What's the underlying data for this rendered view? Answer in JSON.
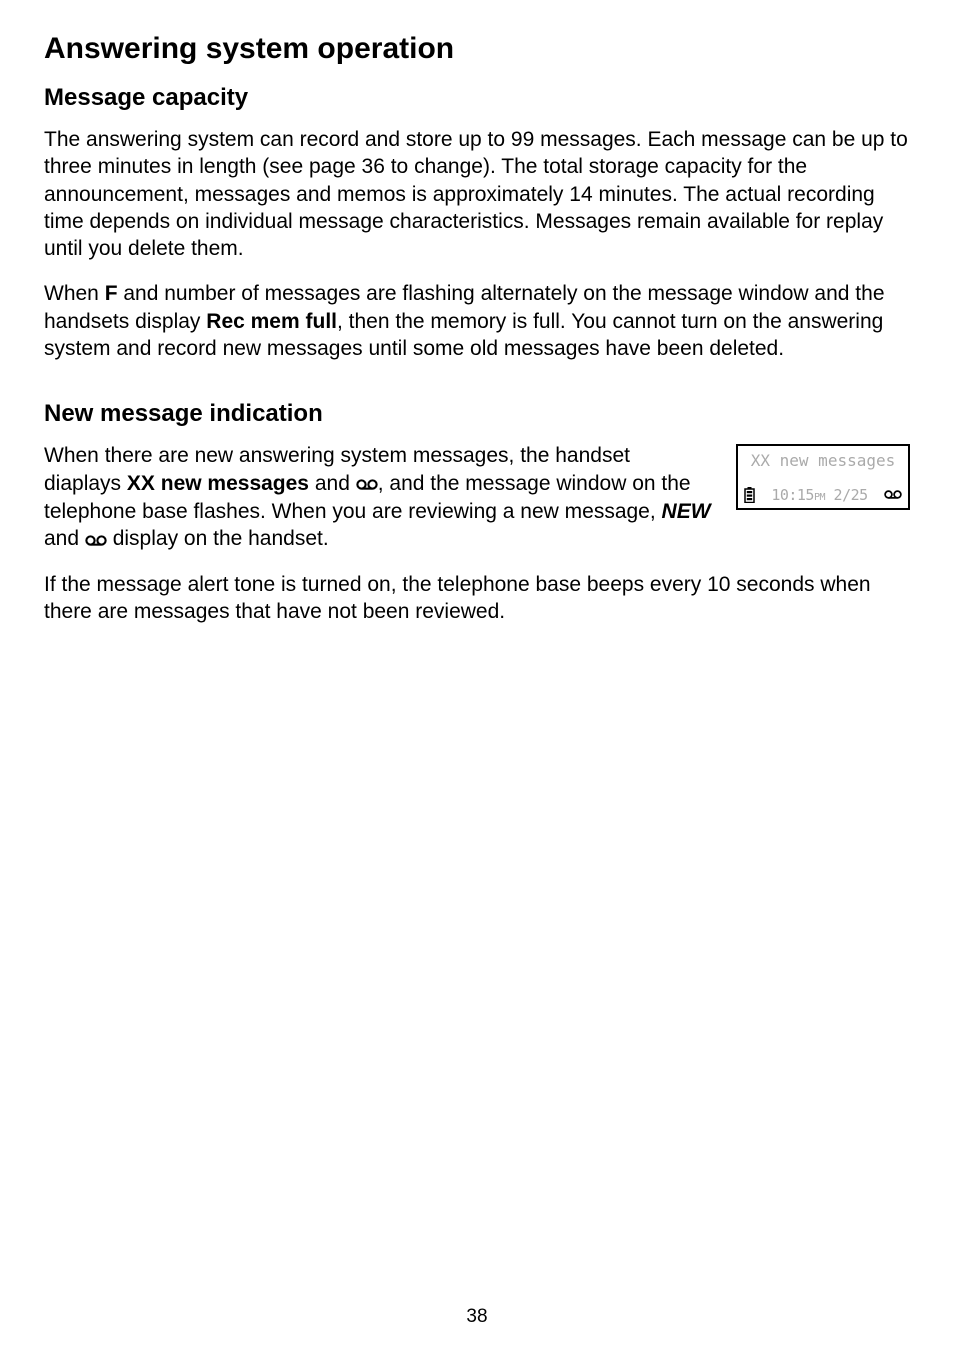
{
  "title": "Answering system operation",
  "section1": {
    "heading": "Message capacity",
    "para1": "The answering system can record and store up to 99 messages. Each message can be up to three minutes in length (see page 36 to change). The total storage capacity for the announcement, messages and memos is approximately 14 minutes. The actual recording time depends on individual message characteristics. Messages remain available for replay until you delete them.",
    "para2_pre": "When ",
    "para2_bold1": "F",
    "para2_mid1": " and number of messages are flashing alternately on the message window and the handsets display ",
    "para2_bold2": "Rec mem full",
    "para2_post": ", then the memory is full. You cannot turn on the answering system and record new messages until some old messages have been deleted."
  },
  "section2": {
    "heading": "New message indication",
    "para1_pre": "When there are new answering system messages, the handset diaplays ",
    "para1_bold1": "XX new messages",
    "para1_mid1": " and ",
    "para1_mid2": ", and the message window on the telephone base flashes. When you are reviewing a new message, ",
    "para1_bold2": "NEW",
    "para1_mid3": " and ",
    "para1_post": " display on the handset.",
    "para2": "If the message alert tone is turned on, the telephone base beeps every 10 seconds when there are messages that have not been reviewed."
  },
  "lcd": {
    "line1": "XX new messages",
    "time_h": "10",
    "time_m": "15",
    "time_ampm": "PM",
    "date": "2/25"
  },
  "page_number": "38"
}
